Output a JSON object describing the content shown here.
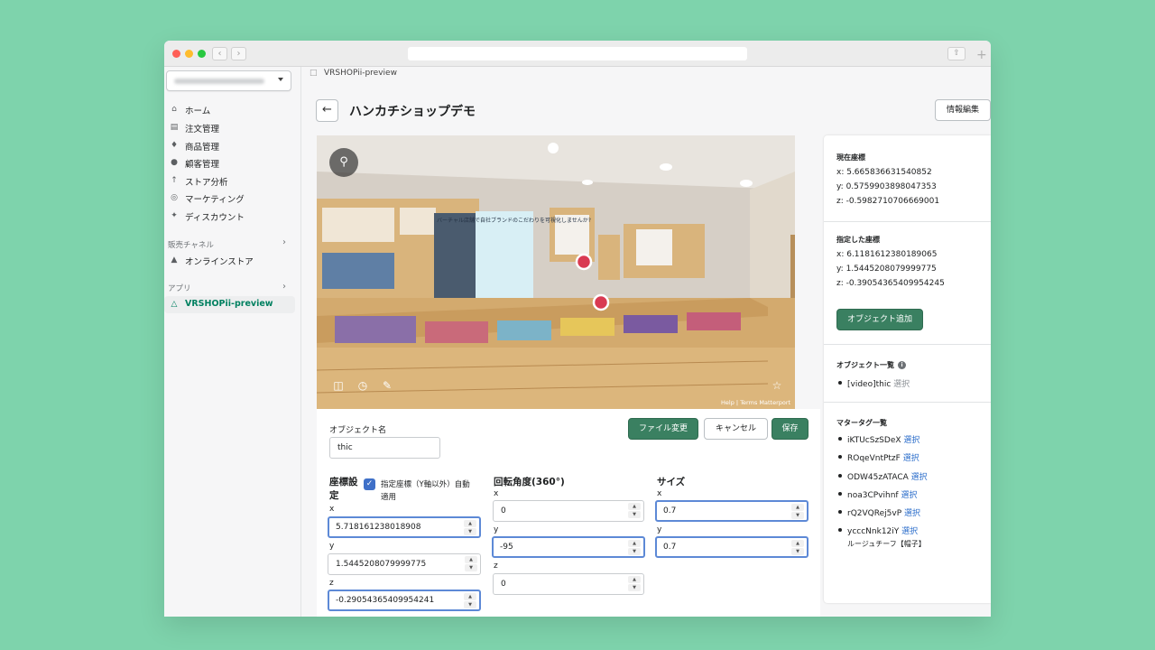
{
  "app": {
    "breadcrumb": "VRSHOPii-preview",
    "page_title": "ハンカチショップデモ",
    "edit_info_label": "情報編集"
  },
  "sidebar": {
    "items": [
      {
        "label": "ホーム",
        "icon": "home-icon"
      },
      {
        "label": "注文管理",
        "icon": "orders-icon"
      },
      {
        "label": "商品管理",
        "icon": "tag-icon"
      },
      {
        "label": "顧客管理",
        "icon": "person-icon"
      },
      {
        "label": "ストア分析",
        "icon": "bar-chart-icon"
      },
      {
        "label": "マーケティング",
        "icon": "target-icon"
      },
      {
        "label": "ディスカウント",
        "icon": "discount-icon"
      }
    ],
    "sales_channels_heading": "販売チャネル",
    "online_store_label": "オンラインストア",
    "apps_heading": "アプリ",
    "active_app_label": "VRSHOPii-preview"
  },
  "viewer": {
    "footer_help": "Help",
    "footer_sep": "|",
    "footer_terms": "Terms",
    "footer_brand": "Matterport",
    "poster_text": "バーチャル店舗で自社ブランドのこだわりを可視化しませんか?"
  },
  "form": {
    "object_name_label": "オブジェクト名",
    "object_name_value": "thic",
    "file_change_label": "ファイル変更",
    "cancel_label": "キャンセル",
    "save_label": "保存",
    "coords": {
      "heading_line1": "座標設",
      "heading_line2": "定",
      "auto_apply_line1": "指定座標（Y軸以外）自動",
      "auto_apply_line2": "適用",
      "auto_apply_checked": true,
      "x_label": "x",
      "x_value": "5.718161238018908",
      "y_label": "y",
      "y_value": "1.5445208079999775",
      "z_label": "z",
      "z_value": "-0.29054365409954241"
    },
    "rotation": {
      "heading": "回転角度(360°)",
      "x_label": "x",
      "x_value": "0",
      "y_label": "y",
      "y_value": "-95",
      "z_label": "z",
      "z_value": "0"
    },
    "size": {
      "heading": "サイズ",
      "x_label": "x",
      "x_value": "0.7",
      "y_label": "y",
      "y_value": "0.7"
    }
  },
  "panel": {
    "current": {
      "heading": "現在座標",
      "x": "x: 5.665836631540852",
      "y": "y: 0.5759903898047353",
      "z": "z: -0.5982710706669001"
    },
    "specified": {
      "heading": "指定した座標",
      "x": "x: 6.1181612380189065",
      "y": "y: 1.5445208079999775",
      "z": "z: -0.39054365409954245",
      "add_object_label": "オブジェクト追加"
    },
    "object_list": {
      "heading": "オブジェクト一覧",
      "items": [
        {
          "name": "[video]thic",
          "action": "選択"
        }
      ]
    },
    "mattertag_list": {
      "heading": "マタータグ一覧",
      "items": [
        {
          "name": "iKTUcSzSDeX",
          "action": "選択"
        },
        {
          "name": "ROqeVntPtzF",
          "action": "選択"
        },
        {
          "name": "ODW45zATACA",
          "action": "選択"
        },
        {
          "name": "noa3CPvihnf",
          "action": "選択"
        },
        {
          "name": "rQ2VQRej5vP",
          "action": "選択"
        },
        {
          "name": "ycccNnk12iY",
          "action": "選択"
        }
      ],
      "trailing_note": "ルージュチーフ【帽子】"
    }
  }
}
